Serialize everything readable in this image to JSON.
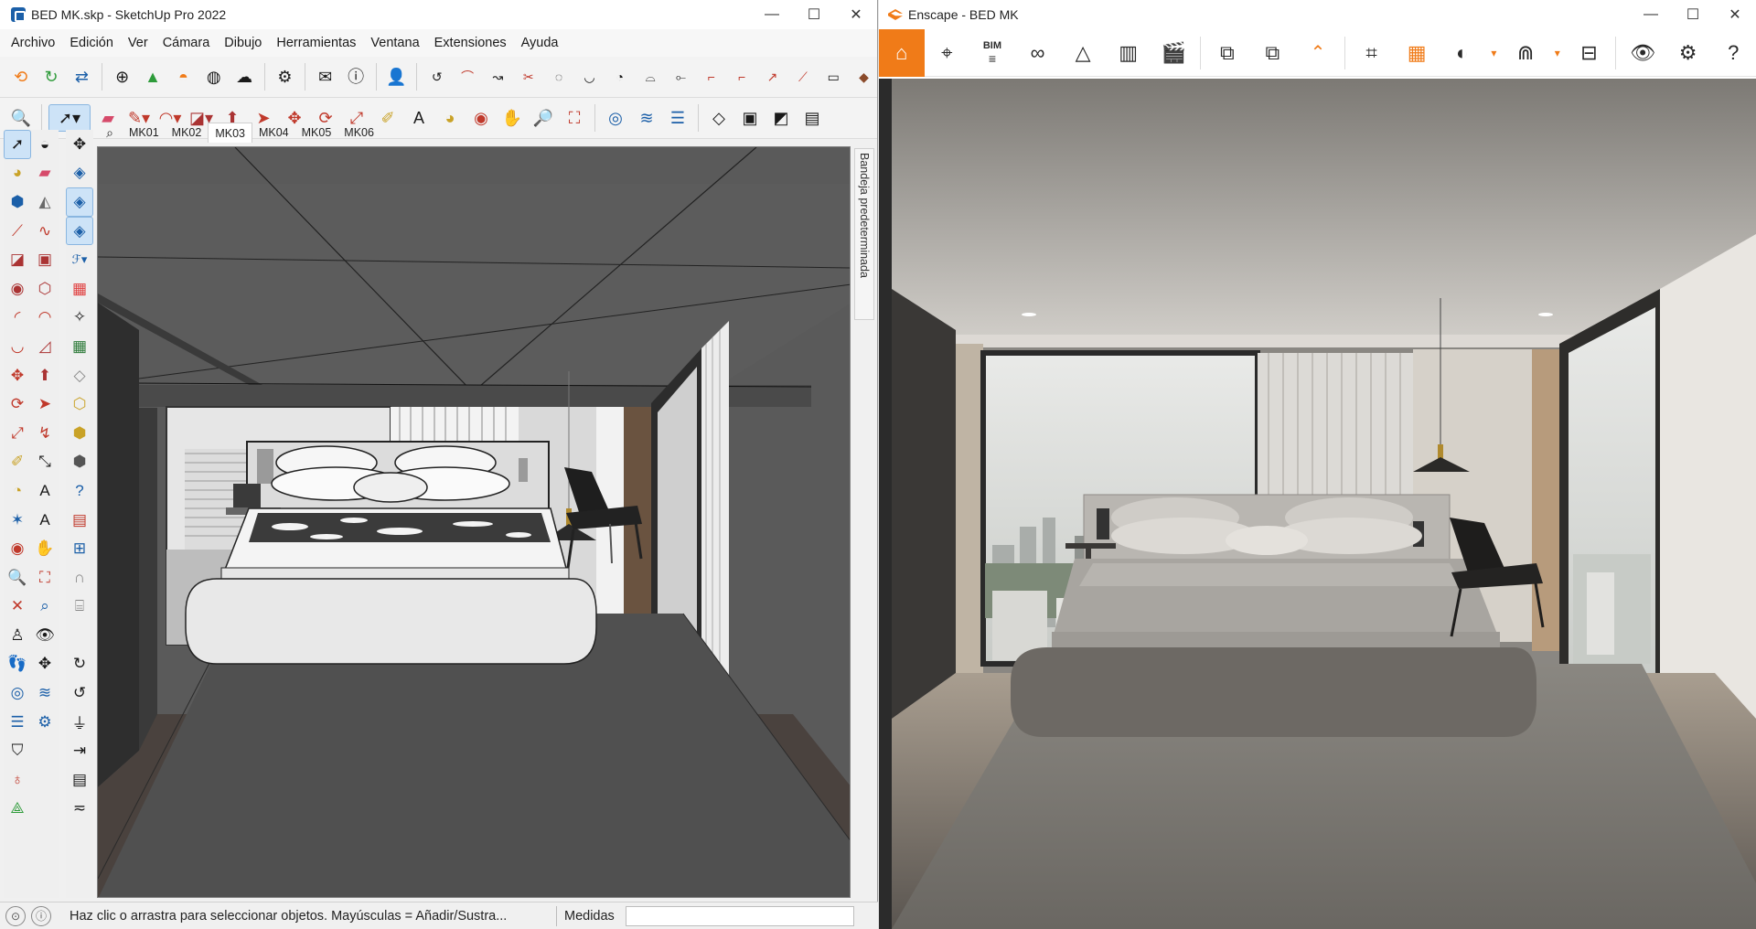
{
  "sketchup": {
    "window_title": "BED MK.skp - SketchUp Pro 2022",
    "window_buttons": [
      "—",
      "☐",
      "✕"
    ],
    "menu": [
      "Archivo",
      "Edición",
      "Ver",
      "Cámara",
      "Dibujo",
      "Herramientas",
      "Ventana",
      "Extensiones",
      "Ayuda"
    ],
    "scenes": [
      "MK01",
      "MK02",
      "MK03",
      "MK04",
      "MK05",
      "MK06"
    ],
    "active_scene": "MK03",
    "tray_label": "Bandeja predeterminada",
    "status_text": "Haz clic o arrastra para seleccionar objetos. Mayúsculas = Añadir/Sustra...",
    "measure_label": "Medidas",
    "measure_value": ""
  },
  "enscape": {
    "window_title": "Enscape - BED MK",
    "window_buttons": [
      "—",
      "☐",
      "✕"
    ],
    "toolbar": {
      "bim_label": "BIM"
    },
    "accent_color": "#f07b18"
  }
}
